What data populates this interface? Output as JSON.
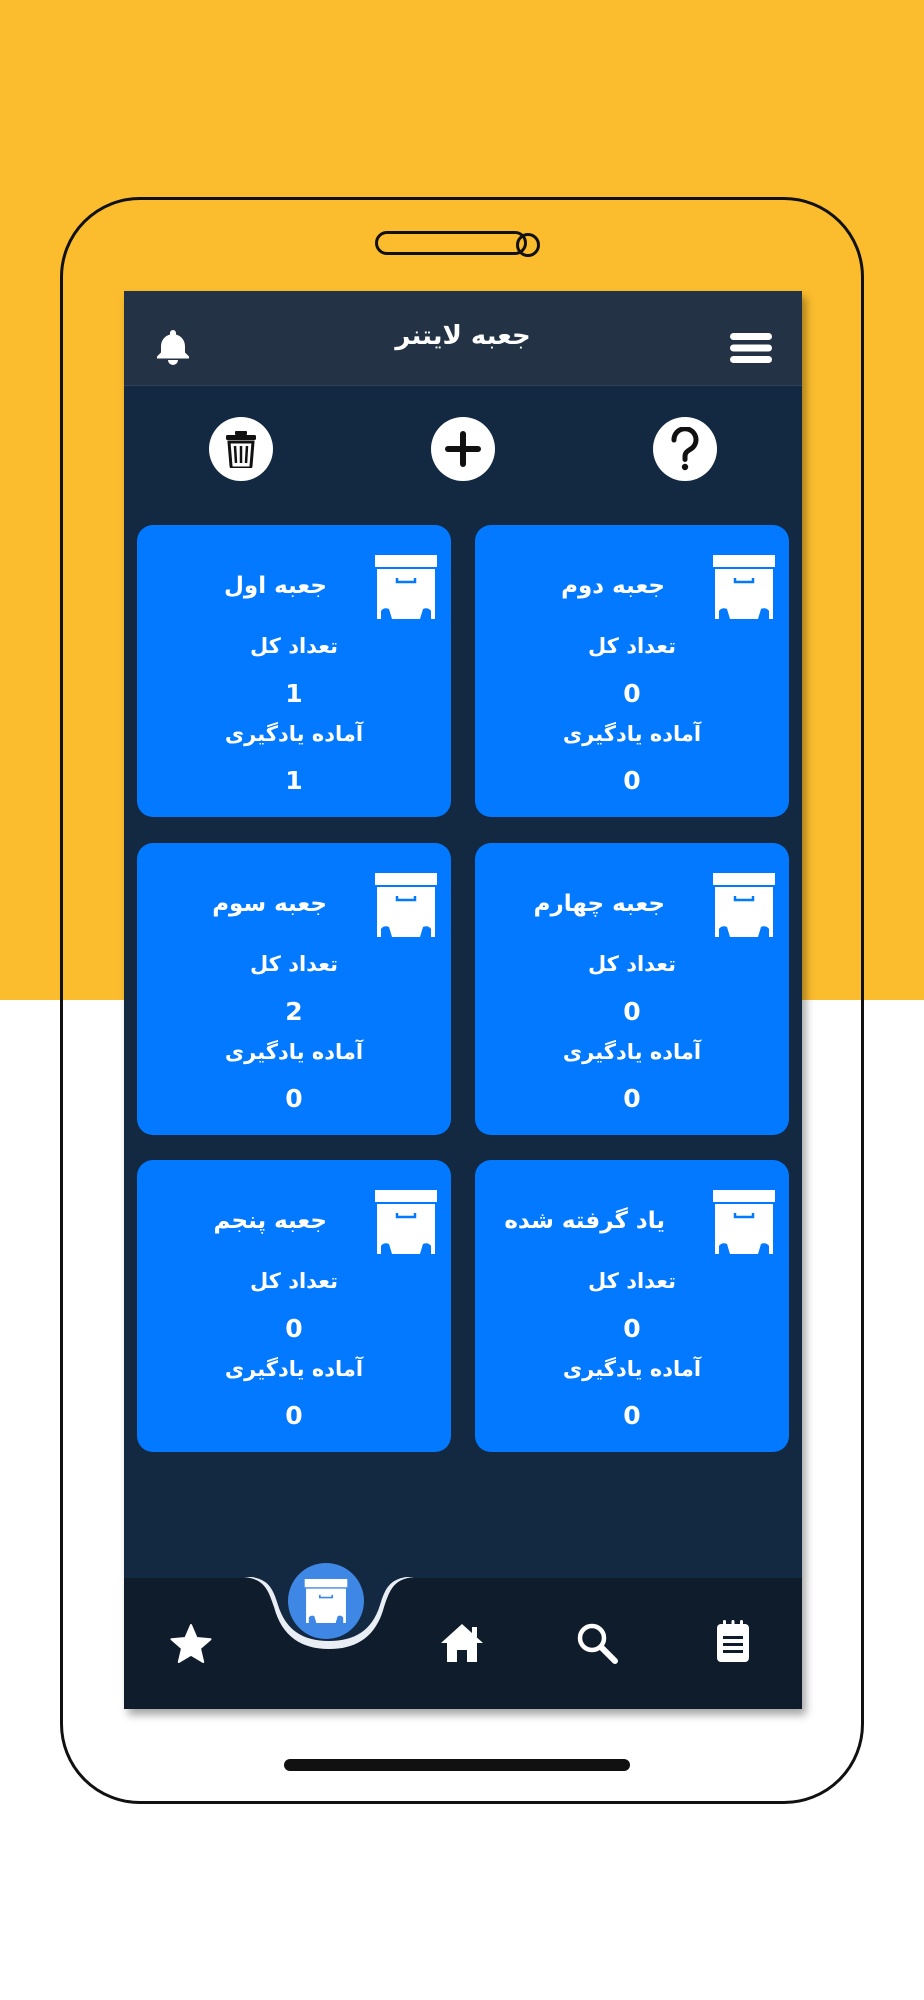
{
  "header": {
    "title": "جعبه لایتنر",
    "icons": {
      "menu": "hamburger-menu-icon",
      "notifications": "bell-icon"
    }
  },
  "actions": {
    "help": "question-icon",
    "add": "plus-icon",
    "delete": "trash-icon"
  },
  "boxes": [
    {
      "name": "جعبه اول",
      "total_label": "تعداد کل",
      "total": "1",
      "ready_label": "آماده یادگیری",
      "ready": "1"
    },
    {
      "name": "جعبه دوم",
      "total_label": "تعداد کل",
      "total": "0",
      "ready_label": "آماده یادگیری",
      "ready": "0"
    },
    {
      "name": "جعبه سوم",
      "total_label": "تعداد کل",
      "total": "2",
      "ready_label": "آماده یادگیری",
      "ready": "0"
    },
    {
      "name": "جعبه چهارم",
      "total_label": "تعداد کل",
      "total": "0",
      "ready_label": "آماده یادگیری",
      "ready": "0"
    },
    {
      "name": "جعبه پنجم",
      "total_label": "تعداد کل",
      "total": "0",
      "ready_label": "آماده یادگیری",
      "ready": "0"
    },
    {
      "name": "یاد گرفته شده",
      "total_label": "تعداد کل",
      "total": "0",
      "ready_label": "آماده یادگیری",
      "ready": "0"
    }
  ],
  "bottom_nav": {
    "items": [
      "star-icon",
      "archive-box-icon",
      "home-icon",
      "search-icon",
      "notes-icon"
    ],
    "active": "archive-box-icon"
  },
  "colors": {
    "background_top": "#FBBD2E",
    "screen": "#132841",
    "topbar": "#243245",
    "card": "#0279FE",
    "nav": "#0F1C2C",
    "active_nav": "#3F87E5"
  }
}
